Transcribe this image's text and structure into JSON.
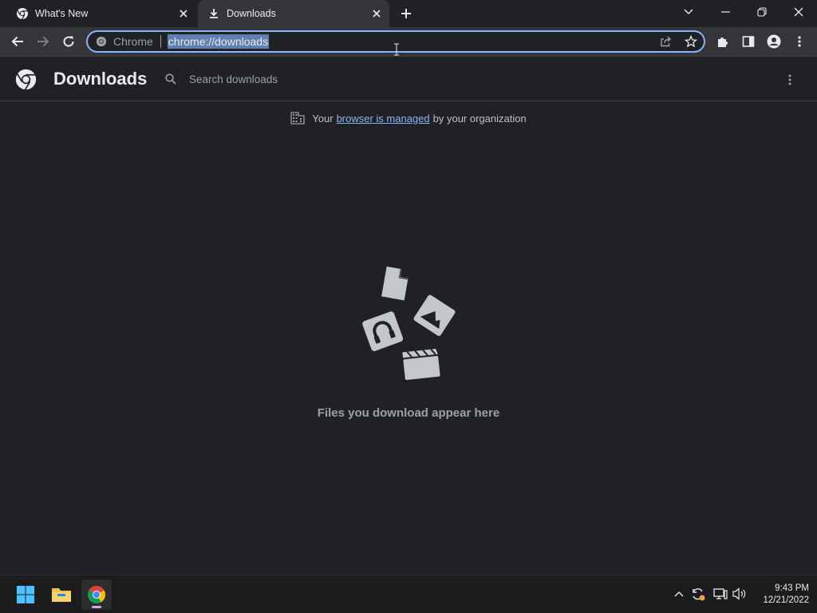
{
  "tabs": [
    {
      "label": "What's New",
      "icon": "chrome-icon"
    },
    {
      "label": "Downloads",
      "icon": "download-icon",
      "active": true
    }
  ],
  "toolbar": {
    "site_label": "Chrome",
    "url": "chrome://downloads"
  },
  "page": {
    "title": "Downloads",
    "search_placeholder": "Search downloads",
    "managed_prefix": "Your",
    "managed_link": "browser is managed",
    "managed_suffix": "by your organization",
    "empty_message": "Files you download appear here"
  },
  "taskbar": {
    "time": "9:43 PM",
    "date": "12/21/2022"
  },
  "colors": {
    "accent": "#8ab4f8",
    "background": "#202124",
    "toolbar": "#35363a"
  }
}
